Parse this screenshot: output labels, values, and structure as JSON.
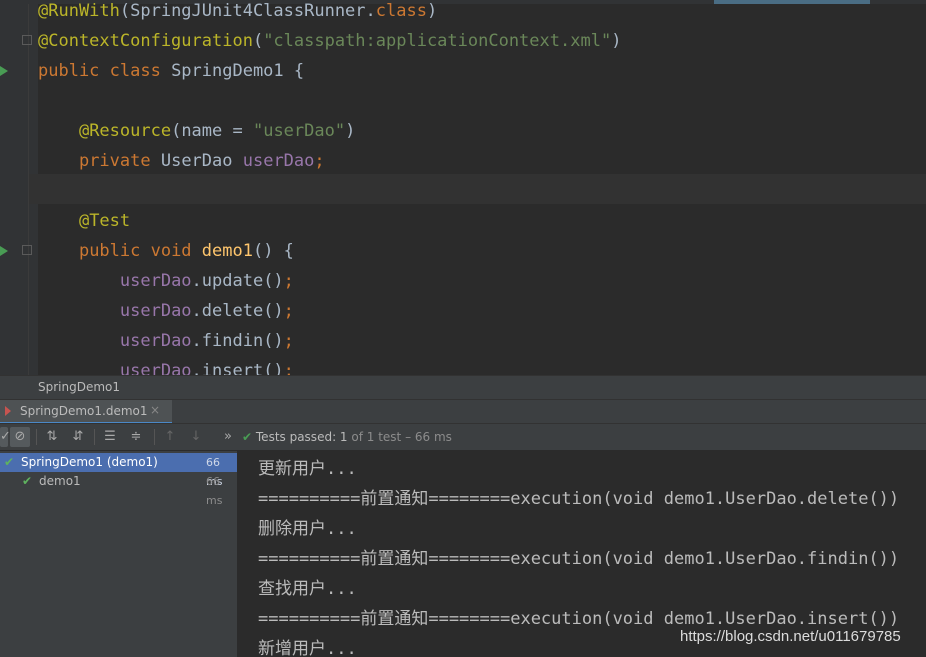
{
  "editor": {
    "lines": [
      {
        "parts": [
          {
            "t": "@RunWith",
            "c": "ann"
          },
          {
            "t": "(SpringJUnit4ClassRunner."
          },
          {
            "t": "class",
            "c": "kw"
          },
          {
            "t": ")"
          }
        ]
      },
      {
        "parts": [
          {
            "t": "@ContextConfiguration",
            "c": "ann"
          },
          {
            "t": "("
          },
          {
            "t": "\"classpath:applicationContext.xml\"",
            "c": "str"
          },
          {
            "t": ")"
          }
        ]
      },
      {
        "parts": [
          {
            "t": "public class ",
            "c": "kw"
          },
          {
            "t": "SpringDemo1 {"
          }
        ]
      },
      {
        "parts": []
      },
      {
        "parts": [
          {
            "t": "    "
          },
          {
            "t": "@Resource",
            "c": "ann"
          },
          {
            "t": "(name = "
          },
          {
            "t": "\"userDao\"",
            "c": "str"
          },
          {
            "t": ")"
          }
        ]
      },
      {
        "parts": [
          {
            "t": "    "
          },
          {
            "t": "private ",
            "c": "kw"
          },
          {
            "t": "UserDao "
          },
          {
            "t": "userDao",
            "c": "fld"
          },
          {
            "t": ";",
            "c": "kw"
          }
        ]
      },
      {
        "parts": []
      },
      {
        "parts": [
          {
            "t": "    "
          },
          {
            "t": "@Test",
            "c": "ann"
          }
        ]
      },
      {
        "parts": [
          {
            "t": "    "
          },
          {
            "t": "public void ",
            "c": "kw"
          },
          {
            "t": "demo1",
            "c": "fn"
          },
          {
            "t": "() {"
          }
        ]
      },
      {
        "parts": [
          {
            "t": "        "
          },
          {
            "t": "userDao",
            "c": "fld"
          },
          {
            "t": ".update()"
          },
          {
            "t": ";",
            "c": "kw"
          }
        ]
      },
      {
        "parts": [
          {
            "t": "        "
          },
          {
            "t": "userDao",
            "c": "fld"
          },
          {
            "t": ".delete()"
          },
          {
            "t": ";",
            "c": "kw"
          }
        ]
      },
      {
        "parts": [
          {
            "t": "        "
          },
          {
            "t": "userDao",
            "c": "fld"
          },
          {
            "t": ".findin()"
          },
          {
            "t": ";",
            "c": "kw"
          }
        ]
      },
      {
        "parts": [
          {
            "t": "        "
          },
          {
            "t": "userDao",
            "c": "fld"
          },
          {
            "t": ".insert()"
          },
          {
            "t": ";",
            "c": "kw"
          }
        ]
      }
    ]
  },
  "breadcrumb": "SpringDemo1",
  "run_tab": {
    "label": "SpringDemo1.demo1",
    "close": "×"
  },
  "toolbar": {
    "status_prefix": "Tests passed: ",
    "status_count": "1",
    "status_suffix": " of 1 test – 66 ms"
  },
  "tree": {
    "items": [
      {
        "name": "SpringDemo1 (demo1)",
        "time": "66 ms"
      },
      {
        "name": "demo1",
        "time": "66 ms"
      }
    ]
  },
  "console": {
    "lines": [
      "更新用户...",
      "==========前置通知========execution(void demo1.UserDao.delete())",
      "删除用户...",
      "==========前置通知========execution(void demo1.UserDao.findin())",
      "查找用户...",
      "==========前置通知========execution(void demo1.UserDao.insert())",
      "新增用户..."
    ]
  },
  "watermark": "https://blog.csdn.net/u011679785",
  "colors": {
    "annotation": "#bbb529",
    "keyword": "#cc7832",
    "string": "#6a8759",
    "field": "#9876aa",
    "method": "#ffc66d",
    "selection": "#4b6eaf",
    "pass": "#499c54"
  }
}
